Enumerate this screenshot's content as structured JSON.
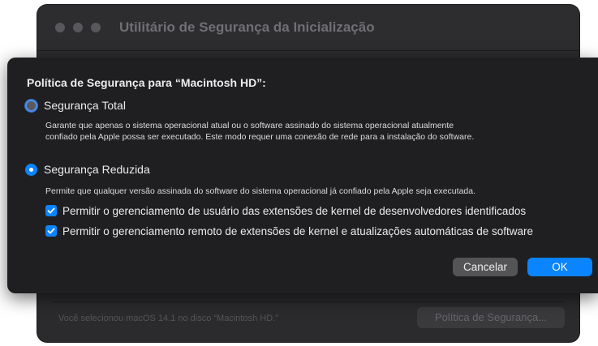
{
  "background_window": {
    "title": "Utilitário de Segurança da Inicialização",
    "footer_text": "Você selecionou macOS 14.1 no disco “Macintosh HD.”",
    "policy_button": "Política de Segurança..."
  },
  "sheet": {
    "title": "Política de Segurança para “Macintosh HD”:",
    "full_security": {
      "label": "Segurança Total",
      "selected": false,
      "description_line1": "Garante que apenas o sistema operacional atual ou o software assinado do sistema operacional atualmente",
      "description_line2": "confiado pela Apple possa ser executado. Este modo requer uma conexão de rede para a instalação do software."
    },
    "reduced_security": {
      "label": "Segurança Reduzida",
      "selected": true,
      "description": "Permite que qualquer versão assinada do software do sistema operacional já confiado pela Apple seja executada."
    },
    "checkboxes": [
      {
        "label": "Permitir o gerenciamento de usuário das extensões de kernel de desenvolvedores identificados",
        "checked": true
      },
      {
        "label": "Permitir o gerenciamento remoto de extensões de kernel e atualizações automáticas de software",
        "checked": true
      }
    ],
    "cancel_label": "Cancelar",
    "ok_label": "OK"
  },
  "colors": {
    "accent": "#0a84ff",
    "sheet_bg": "#1f1f21",
    "window_bg": "#2b2b2d"
  },
  "icons": {
    "window_controls": [
      "close-icon",
      "minimize-icon",
      "zoom-icon"
    ],
    "checkbox_mark": "checkmark-icon"
  }
}
